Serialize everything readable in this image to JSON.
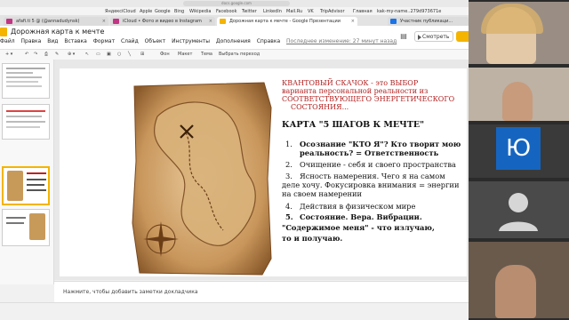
{
  "browser": {
    "url_strip": "docs.google.com",
    "bookmarks": [
      "Яндекс",
      "iCloud",
      "Apple",
      "Google",
      "Bing",
      "Wikipedia",
      "Facebook",
      "Twitter",
      "LinkedIn",
      "Mail.Ru",
      "VK",
      "TripAdvisor",
      "Главная",
      "kak-my-name..279d973671e"
    ],
    "tabs": [
      {
        "label": "afafi.ti 5 @ (@annadudynsk)",
        "fav_color": "#c13584"
      },
      {
        "label": "iCloud • Фото и видео в Instagram",
        "fav_color": "#c13584"
      },
      {
        "label": "Дорожная карта к мечте - Google Презентации",
        "fav_color": "#f4b400",
        "active": true
      },
      {
        "label": "Участник публикаци...",
        "fav_color": "#1a73e8"
      }
    ]
  },
  "app": {
    "doc_title": "Дорожная карта к мечте",
    "menus": [
      "Файл",
      "Правка",
      "Вид",
      "Вставка",
      "Формат",
      "Слайд",
      "Объект",
      "Инструменты",
      "Дополнения",
      "Справка"
    ],
    "last_edit": "Последнее изменение: 27 минут назад",
    "present_label": "Смотреть",
    "toolbar": {
      "bg": "Фон",
      "layout": "Макет",
      "theme": "Тема",
      "transition": "Выбрать переход"
    }
  },
  "slide": {
    "intro_lines": [
      "КВАНТОВЫЙ СКАЧОК - это  ВЫБОР",
      "варианта персональной реальности из",
      "СООТВЕТСТВУЮЩЕГО ЭНЕРГЕТИЧЕСКОГО",
      "СОСТОЯНИЯ..."
    ],
    "heading": "КАРТА \"5 ШАГОВ К МЕЧТЕ\"",
    "items": {
      "n1": "1.",
      "i1a": "Осознание \"КТО Я\"? Кто творит мою",
      "i1b": "реальность? = Ответственность",
      "n2": "2.",
      "i2": "Очищение - себя и своего пространства",
      "n3": "3.",
      "i3a": "Ясность намерения. Чего я на самом",
      "i3b": "деле хочу. Фокусировка внимания = энергии",
      "i3c": "на своем намерении",
      "n4": "4.",
      "i4": "Действия в физическом мире",
      "n5": "5.",
      "i5": "Состояние. Вера. Вибрации.",
      "closing_a": "\"Содержимое меня\" - что излучаю,",
      "closing_b": "то и получаю."
    }
  },
  "notes": {
    "placeholder": "Нажмите, чтобы добавить заметки докладчика"
  },
  "participants": {
    "letter_avatar": "Ю"
  },
  "colors": {
    "accent": "#f4b400",
    "red_text": "#b22222",
    "avatar_blue": "#1565c0"
  }
}
